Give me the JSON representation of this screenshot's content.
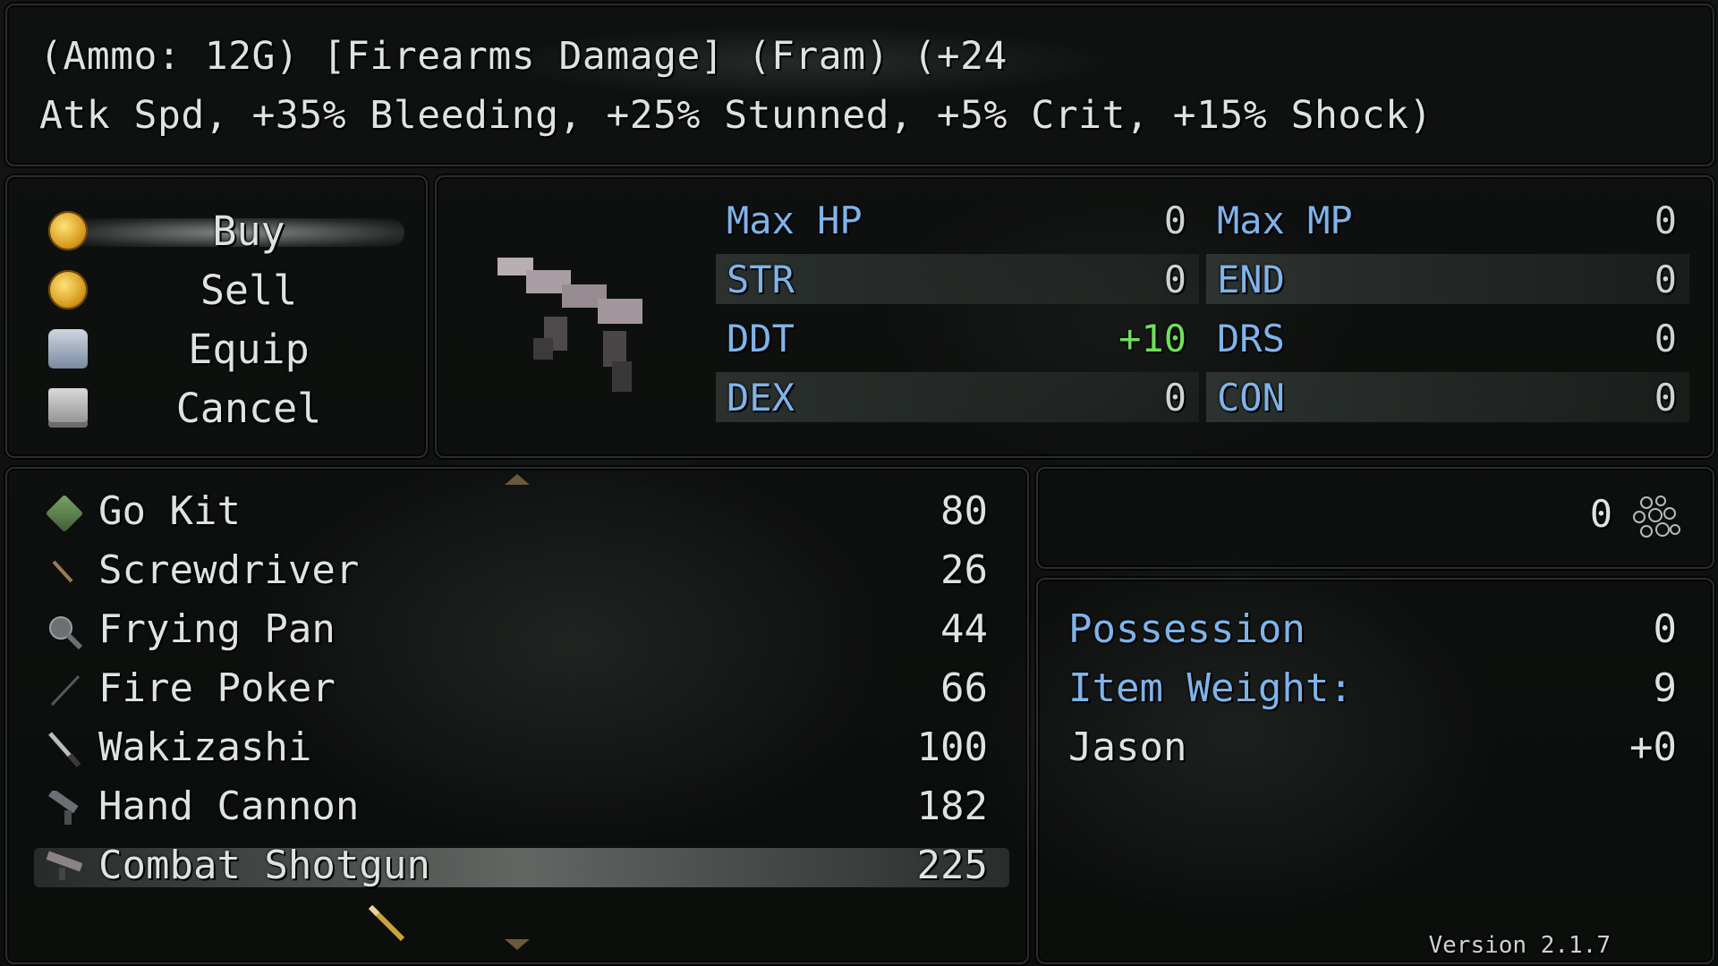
{
  "help": {
    "line1": "(Ammo: 12G) [Firearms Damage] (Fram) (+24",
    "line2": "Atk Spd, +35% Bleeding, +25% Stunned, +5% Crit, +15% Shock)"
  },
  "commands": [
    {
      "label": "Buy",
      "icon": "coin-icon"
    },
    {
      "label": "Sell",
      "icon": "coin-icon"
    },
    {
      "label": "Equip",
      "icon": "gauntlet-icon"
    },
    {
      "label": "Cancel",
      "icon": "chest-icon"
    }
  ],
  "stats": {
    "left": [
      {
        "name": "Max HP",
        "value": "0"
      },
      {
        "name": "STR",
        "value": "0"
      },
      {
        "name": "DDT",
        "value": "+10"
      },
      {
        "name": "DEX",
        "value": "0"
      }
    ],
    "right": [
      {
        "name": "Max MP",
        "value": "0"
      },
      {
        "name": "END",
        "value": "0"
      },
      {
        "name": "DRS",
        "value": "0"
      },
      {
        "name": "CON",
        "value": "0"
      }
    ],
    "increase_color": "#6ee05a",
    "stat_name_color": "#7fb3ea"
  },
  "shop_items": [
    {
      "name": "Go Kit",
      "price": "80",
      "icon": "kit-box-icon"
    },
    {
      "name": "Screwdriver",
      "price": "26",
      "icon": "screwdriver-icon"
    },
    {
      "name": "Frying Pan",
      "price": "44",
      "icon": "frying-pan-icon"
    },
    {
      "name": "Fire Poker",
      "price": "66",
      "icon": "fire-poker-icon"
    },
    {
      "name": "Wakizashi",
      "price": "100",
      "icon": "sword-icon"
    },
    {
      "name": "Hand Cannon",
      "price": "182",
      "icon": "pistol-icon"
    },
    {
      "name": "Combat Shotgun",
      "price": "225",
      "icon": "shotgun-icon"
    }
  ],
  "selected_item": "Combat Shotgun",
  "gold": {
    "amount": "0",
    "icon": "currency-icon"
  },
  "info": {
    "possession_label": "Possession",
    "possession_value": "0",
    "weight_label": "Item Weight:",
    "weight_value": "9",
    "actor_name": "Jason",
    "actor_value": "+0"
  },
  "version": "Version 2.1.7"
}
